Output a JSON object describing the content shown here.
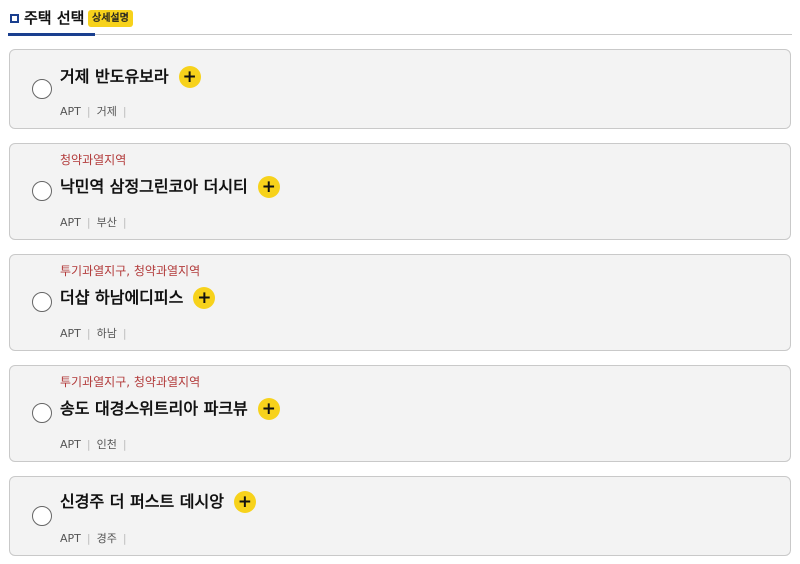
{
  "header": {
    "title": "주택 선택",
    "detail_badge": "상세설명"
  },
  "icons": {
    "plus": "plus-icon",
    "radio": "radio-icon"
  },
  "colors": {
    "accent_blue": "#1a3f8f",
    "badge_yellow": "#f7d21b",
    "tag_red": "#b23a3a"
  },
  "listings": [
    {
      "tag": "",
      "name": "거제 반도유보라",
      "type": "APT",
      "region": "거제"
    },
    {
      "tag": "청약과열지역",
      "name": "낙민역 삼정그린코아 더시티",
      "type": "APT",
      "region": "부산"
    },
    {
      "tag": "투기과열지구, 청약과열지역",
      "name": "더샵 하남에디피스",
      "type": "APT",
      "region": "하남"
    },
    {
      "tag": "투기과열지구, 청약과열지역",
      "name": "송도 대경스위트리아 파크뷰",
      "type": "APT",
      "region": "인천"
    },
    {
      "tag": "",
      "name": "신경주 더 퍼스트 데시앙",
      "type": "APT",
      "region": "경주"
    }
  ],
  "plus_label": "+",
  "separator": "|"
}
